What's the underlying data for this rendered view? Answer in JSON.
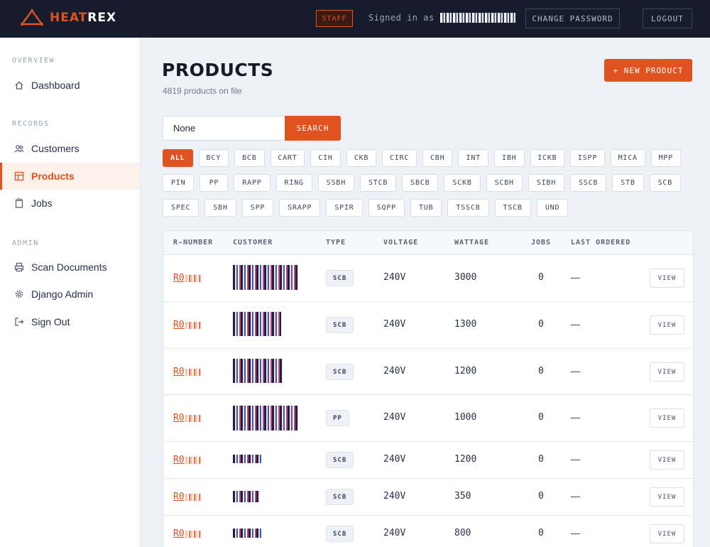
{
  "brand": {
    "name_part1": "HEAT",
    "name_part2": "REX",
    "accent": "#e05220"
  },
  "topbar": {
    "staff_badge": "STAFF",
    "signed_in_label": "Signed in as",
    "change_password": "CHANGE PASSWORD",
    "logout": "LOGOUT"
  },
  "sidebar": {
    "sections": [
      {
        "title": "OVERVIEW"
      },
      {
        "title": "RECORDS"
      },
      {
        "title": "ADMIN"
      }
    ],
    "items": [
      {
        "label": "Dashboard",
        "icon": "home-icon"
      },
      {
        "label": "Customers",
        "icon": "users-icon"
      },
      {
        "label": "Products",
        "icon": "grid-icon",
        "active": true
      },
      {
        "label": "Jobs",
        "icon": "clipboard-icon"
      },
      {
        "label": "Scan Documents",
        "icon": "printer-icon"
      },
      {
        "label": "Django Admin",
        "icon": "gear-icon"
      },
      {
        "label": "Sign Out",
        "icon": "sign-out-icon"
      }
    ]
  },
  "main": {
    "title": "PRODUCTS",
    "subtitle": "4819 products on file",
    "new_button": "+ NEW PRODUCT",
    "search": {
      "value": "None",
      "button": "SEARCH"
    },
    "filters": {
      "rows": [
        [
          "ALL",
          "BCY",
          "BCB",
          "CART",
          "CIH",
          "CKB",
          "CIRC",
          "CBH",
          "INT",
          "IBH",
          "ICKB",
          "ISPP",
          "MICA",
          "MPP"
        ],
        [
          "PIN",
          "PP",
          "RAPP",
          "RING",
          "SSBH",
          "STCB",
          "SBCB",
          "SCKB",
          "SCBH",
          "SIBH",
          "SSCB",
          "STB",
          "SCB"
        ],
        [
          "SPEC",
          "SBH",
          "SPP",
          "SRAPP",
          "SPIR",
          "SQPP",
          "TUB",
          "TSSCB",
          "TSCB",
          "UND"
        ]
      ],
      "active": "ALL"
    }
  },
  "table": {
    "headers": {
      "rnumber": "R-NUMBER",
      "customer": "CUSTOMER",
      "type": "TYPE",
      "voltage": "VOLTAGE",
      "wattage": "WATTAGE",
      "jobs": "JOBS",
      "last_ordered": "LAST ORDERED"
    },
    "rows": [
      {
        "rnumber": "R0",
        "type": "SCB",
        "voltage": "240V",
        "wattage": "3000",
        "jobs": "0",
        "last_ordered": "—",
        "view": "VIEW"
      },
      {
        "rnumber": "R0",
        "type": "SCB",
        "voltage": "240V",
        "wattage": "1300",
        "jobs": "0",
        "last_ordered": "—",
        "view": "VIEW"
      },
      {
        "rnumber": "R0",
        "type": "SCB",
        "voltage": "240V",
        "wattage": "1200",
        "jobs": "0",
        "last_ordered": "—",
        "view": "VIEW"
      },
      {
        "rnumber": "R0",
        "type": "PP",
        "voltage": "240V",
        "wattage": "1000",
        "jobs": "0",
        "last_ordered": "—",
        "view": "VIEW"
      },
      {
        "rnumber": "R0",
        "type": "SCB",
        "voltage": "240V",
        "wattage": "1200",
        "jobs": "0",
        "last_ordered": "—",
        "view": "VIEW"
      },
      {
        "rnumber": "R0",
        "type": "SCB",
        "voltage": "240V",
        "wattage": "350",
        "jobs": "0",
        "last_ordered": "—",
        "view": "VIEW"
      },
      {
        "rnumber": "R0",
        "type": "SCB",
        "voltage": "240V",
        "wattage": "800",
        "jobs": "0",
        "last_ordered": "—",
        "view": "VIEW"
      }
    ]
  }
}
